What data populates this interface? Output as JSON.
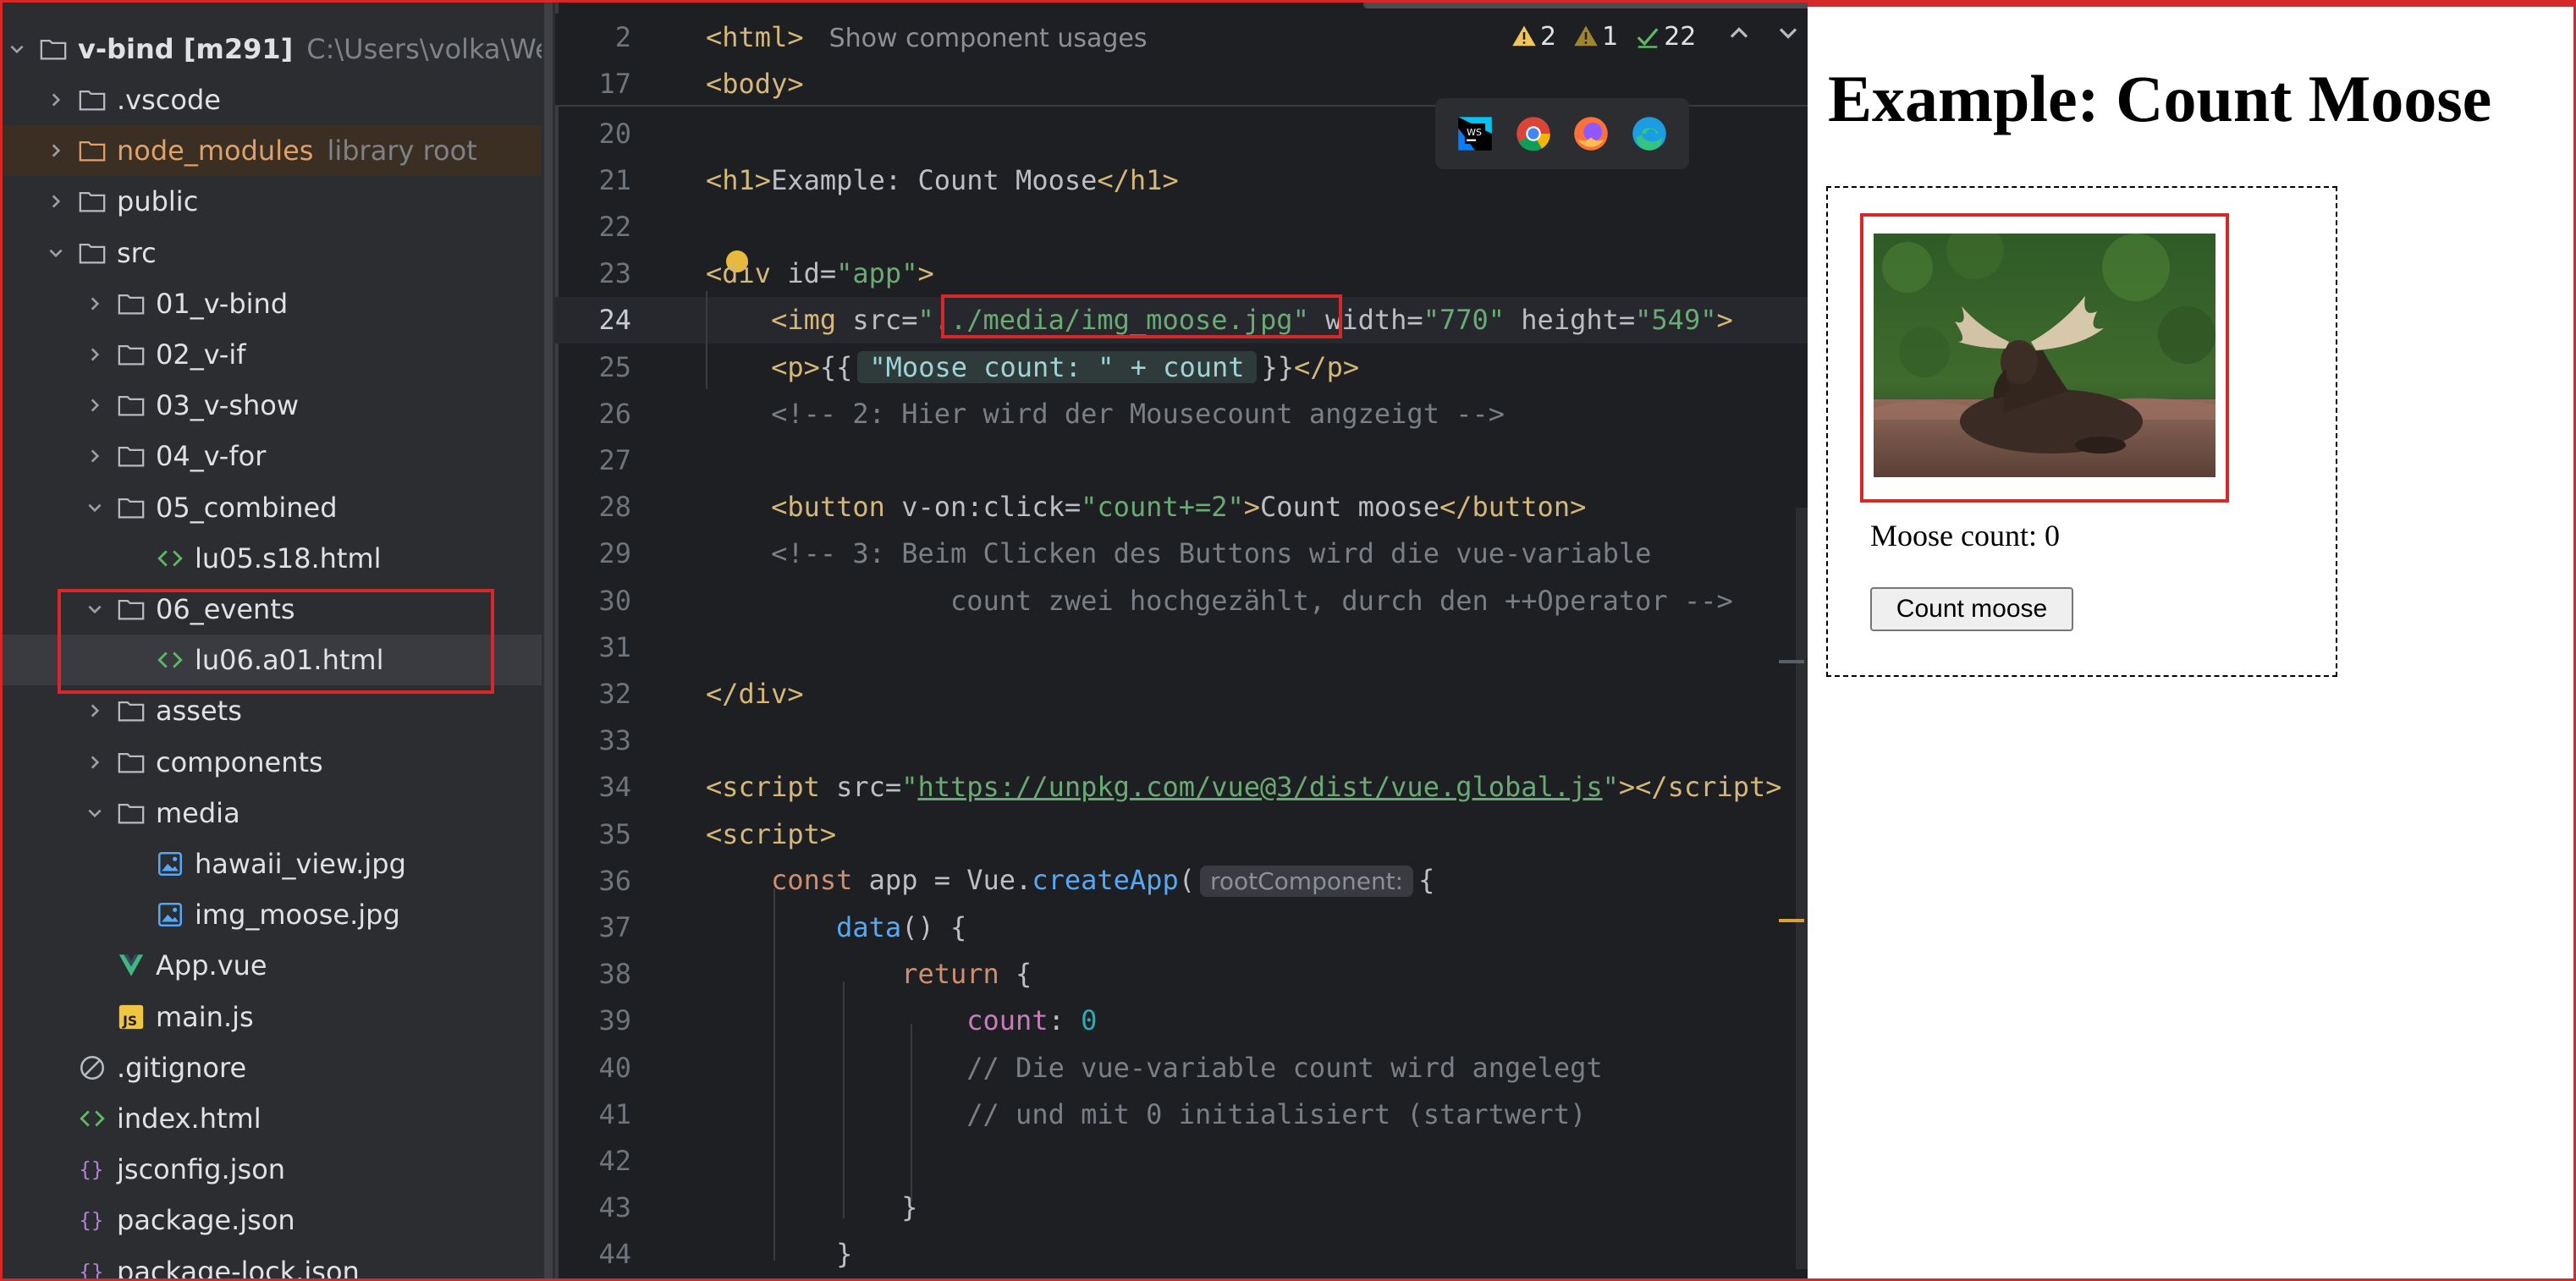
{
  "project_tree": {
    "root": {
      "name": "v-bind [m291]",
      "path": "C:\\Users\\volka\\Webs"
    },
    "items": [
      {
        "name": ".vscode",
        "type": "folder",
        "state": "collapsed"
      },
      {
        "name": "node_modules",
        "hint": "library root",
        "type": "folder",
        "state": "collapsed"
      },
      {
        "name": "public",
        "type": "folder",
        "state": "collapsed"
      },
      {
        "name": "src",
        "type": "folder",
        "state": "expanded"
      },
      {
        "name": "01_v-bind",
        "type": "folder",
        "state": "collapsed"
      },
      {
        "name": "02_v-if",
        "type": "folder",
        "state": "collapsed"
      },
      {
        "name": "03_v-show",
        "type": "folder",
        "state": "collapsed"
      },
      {
        "name": "04_v-for",
        "type": "folder",
        "state": "collapsed"
      },
      {
        "name": "05_combined",
        "type": "folder",
        "state": "expanded"
      },
      {
        "name": "lu05.s18.html",
        "type": "html"
      },
      {
        "name": "06_events",
        "type": "folder",
        "state": "expanded"
      },
      {
        "name": "lu06.a01.html",
        "type": "html"
      },
      {
        "name": "assets",
        "type": "folder",
        "state": "collapsed"
      },
      {
        "name": "components",
        "type": "folder",
        "state": "collapsed"
      },
      {
        "name": "media",
        "type": "folder",
        "state": "expanded"
      },
      {
        "name": "hawaii_view.jpg",
        "type": "image"
      },
      {
        "name": "img_moose.jpg",
        "type": "image"
      },
      {
        "name": "App.vue",
        "type": "vue"
      },
      {
        "name": "main.js",
        "type": "js"
      },
      {
        "name": ".gitignore",
        "type": "ignore"
      },
      {
        "name": "index.html",
        "type": "html"
      },
      {
        "name": "jsconfig.json",
        "type": "json"
      },
      {
        "name": "package.json",
        "type": "json"
      },
      {
        "name": "package-lock.json",
        "type": "json"
      }
    ]
  },
  "editor": {
    "sticky": [
      {
        "ln": "2",
        "tag": "<html>",
        "usages": "Show component usages"
      },
      {
        "ln": "17",
        "tag": "<body>"
      }
    ],
    "inspections": {
      "warnings": "2",
      "weak_warnings": "1",
      "ok": "22"
    },
    "line_numbers": [
      "20",
      "21",
      "22",
      "23",
      "24",
      "25",
      "26",
      "27",
      "28",
      "29",
      "30",
      "31",
      "32",
      "33",
      "34",
      "35",
      "36",
      "37",
      "38",
      "39",
      "40",
      "41",
      "42",
      "43",
      "44"
    ],
    "code": {
      "h1_text": "Example: Count Moose",
      "div_attr": "id",
      "div_val": "\"app\"",
      "img_src": "\"../media/img_moose.jpg\"",
      "img_width": "\"770\"",
      "img_height": "\"549\"",
      "moustache_expr": "\"Moose count: \" + count",
      "comment2": "<!-- 2: Hier wird der Mousecount angzeigt -->",
      "button_event": "\"count+=2\"",
      "button_text": "Count moose",
      "comment3a": "<!-- 3: Beim Clicken des Buttons wird die vue-variable",
      "comment3b": "count zwei hochgezählt, durch den ++Operator -->",
      "script_src": "https://unpkg.com/vue@3/dist/vue.global.js",
      "root_hint": "rootComponent:",
      "count_key": "count",
      "count_val": "0",
      "comment4a": "// Die vue-variable count wird angelegt",
      "comment4b": "// und mit 0 initialisiert (startwert)"
    }
  },
  "preview": {
    "heading": "Example: Count Moose",
    "count_text": "Moose count: 0",
    "button": "Count moose"
  }
}
